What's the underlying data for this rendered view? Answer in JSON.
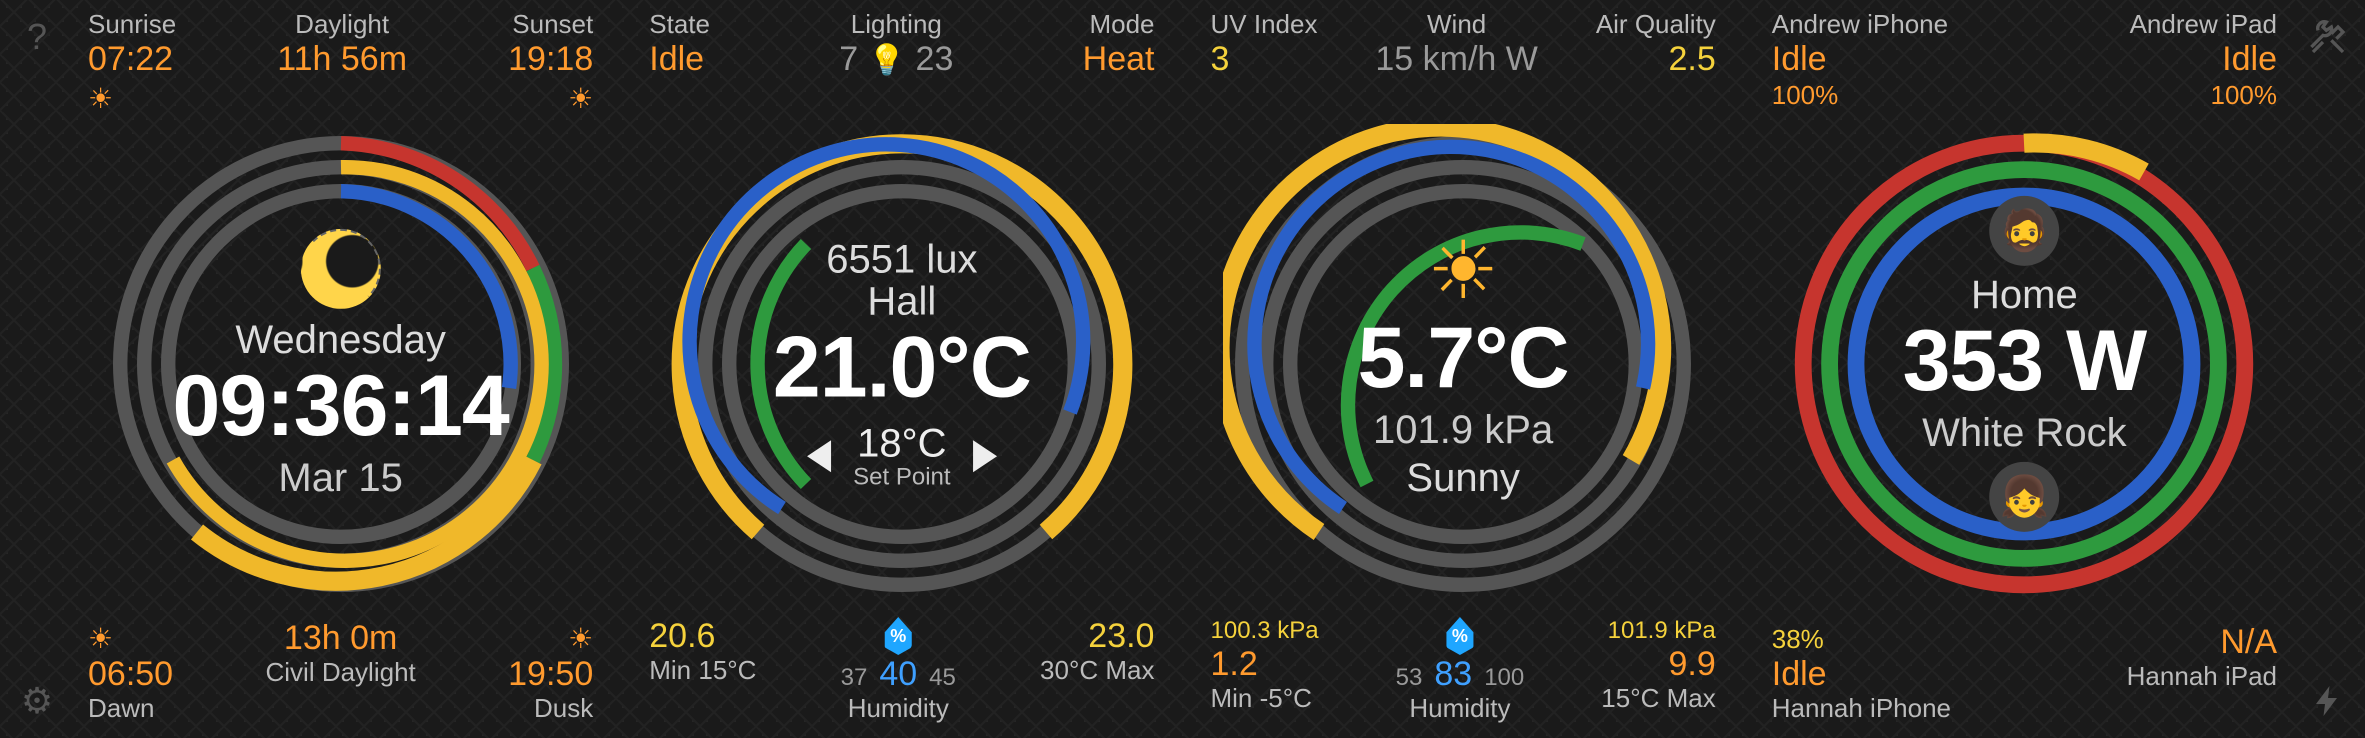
{
  "corners": {
    "help": "?",
    "tools": "✖",
    "settings": "⚙",
    "power": "⚡"
  },
  "panel1": {
    "top": {
      "sunrise": {
        "label": "Sunrise",
        "value": "07:22"
      },
      "daylight": {
        "label": "Daylight",
        "value": "11h 56m"
      },
      "sunset": {
        "label": "Sunset",
        "value": "19:18"
      }
    },
    "center": {
      "weekday": "Wednesday",
      "time": "09:36:14",
      "date": "Mar 15"
    },
    "bottom": {
      "dawn": {
        "value": "06:50",
        "label": "Dawn"
      },
      "civil": {
        "value": "13h 0m",
        "label": "Civil Daylight"
      },
      "dusk": {
        "value": "19:50",
        "label": "Dusk"
      }
    }
  },
  "panel2": {
    "top": {
      "state": {
        "label": "State",
        "value": "Idle"
      },
      "lighting": {
        "label": "Lighting",
        "on": "7",
        "off": "23"
      },
      "mode": {
        "label": "Mode",
        "value": "Heat"
      }
    },
    "center": {
      "lux": "6551 lux",
      "room": "Hall",
      "temp": "21.0°C",
      "setpoint": "18°C",
      "setpoint_label": "Set Point"
    },
    "bottom": {
      "min": {
        "value": "20.6",
        "label": "Min 15°C"
      },
      "hum": {
        "lo": "37",
        "value": "40",
        "hi": "45",
        "label": "Humidity"
      },
      "max": {
        "value": "23.0",
        "label": "30°C Max"
      }
    }
  },
  "panel3": {
    "top": {
      "uv": {
        "label": "UV Index",
        "value": "3"
      },
      "wind": {
        "label": "Wind",
        "value": "15 km/h W"
      },
      "aq": {
        "label": "Air Quality",
        "value": "2.5"
      }
    },
    "center": {
      "temp": "5.7°C",
      "pressure": "101.9 kPa",
      "cond": "Sunny"
    },
    "bottom": {
      "min": {
        "value": "1.2",
        "label": "Min -5°C",
        "extra": "100.3 kPa"
      },
      "hum": {
        "lo": "53",
        "value": "83",
        "hi": "100",
        "label": "Humidity"
      },
      "max": {
        "value": "9.9",
        "label": "15°C Max",
        "extra": "101.9 kPa"
      }
    }
  },
  "panel4": {
    "top": {
      "dev1": {
        "label": "Andrew iPhone",
        "value": "Idle",
        "pct": "100%"
      },
      "dev2": {
        "label": "Andrew iPad",
        "value": "Idle",
        "pct": "100%"
      }
    },
    "center": {
      "title": "Home",
      "power": "353 W",
      "loc": "White Rock"
    },
    "bottom": {
      "dev3": {
        "value": "Idle",
        "label": "Hannah iPhone",
        "pct": "38%"
      },
      "dev4": {
        "value": "N/A",
        "label": "Hannah iPad"
      }
    }
  }
}
